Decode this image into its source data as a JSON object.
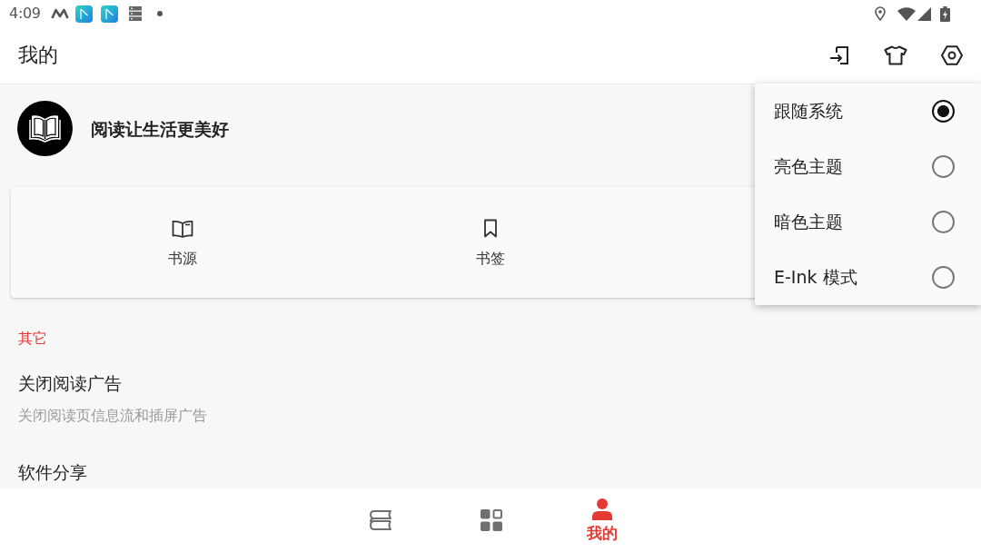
{
  "status_bar": {
    "time": "4:09"
  },
  "app_bar": {
    "title": "我的"
  },
  "profile": {
    "motto": "阅读让生活更美好"
  },
  "shortcuts": [
    {
      "label": "书源"
    },
    {
      "label": "书签"
    }
  ],
  "settings": {
    "header": "其它",
    "items": [
      {
        "title": "关闭阅读广告",
        "summary": "关闭阅读页信息流和插屏广告"
      },
      {
        "title": "软件分享"
      }
    ]
  },
  "bottom_nav": [
    {
      "selected": false
    },
    {
      "selected": false
    },
    {
      "label": "我的",
      "selected": true
    }
  ],
  "theme_menu": [
    {
      "label": "跟随系统",
      "selected": true
    },
    {
      "label": "亮色主题",
      "selected": false
    },
    {
      "label": "暗色主题",
      "selected": false
    },
    {
      "label": "E-Ink 模式",
      "selected": false
    }
  ]
}
